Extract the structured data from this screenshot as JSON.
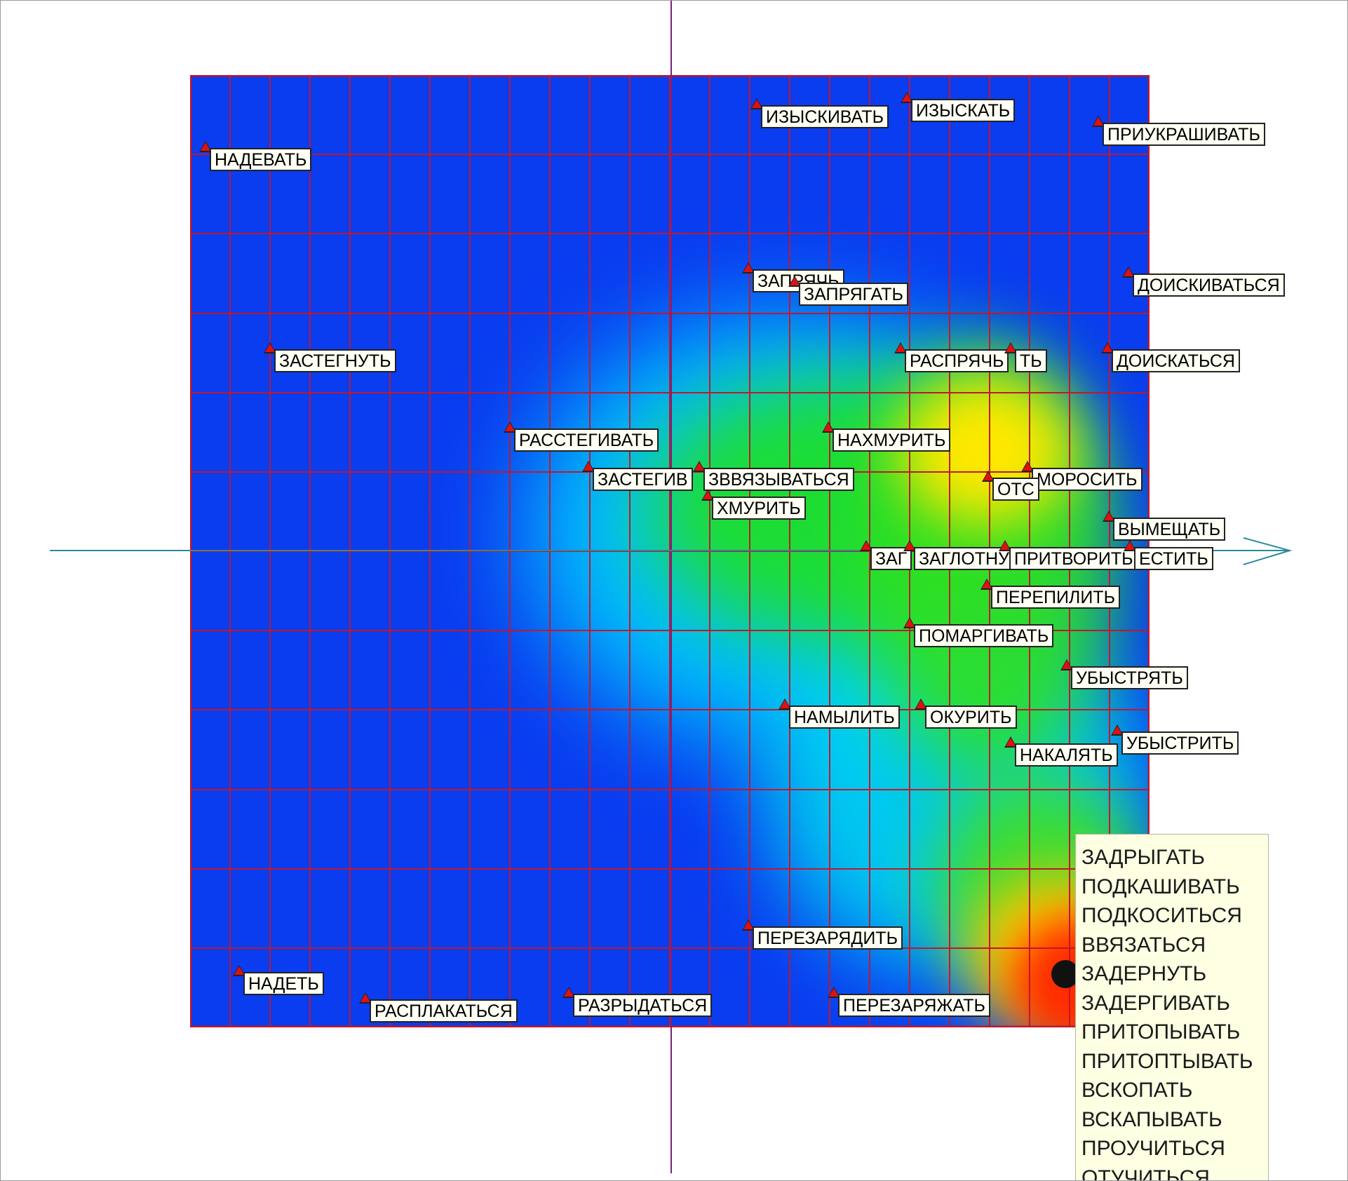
{
  "colors": {
    "low": "#0a3cf0",
    "mid": "#00e5ff",
    "green": "#18e018",
    "yellow": "#ffee00",
    "high": "#ff2a00",
    "grid_line": "#c0182c",
    "axis_vertical": "#7a2080",
    "axis_horizontal": "#2a8a9a",
    "tooltip_bg": "#ffffe3"
  },
  "grid": {
    "columns": 24,
    "rows": 12
  },
  "points": [
    {
      "label": "НАДЕВАТЬ"
    },
    {
      "label": "ИЗЫСКИВАТЬ"
    },
    {
      "label": "ИЗЫСКАТЬ"
    },
    {
      "label": "ПРИУКРАШИВАТЬ"
    },
    {
      "label": "ЗАПРЯЧЬ"
    },
    {
      "label": "ЗАПРЯГАТЬ"
    },
    {
      "label": "ДОИСКИВАТЬСЯ"
    },
    {
      "label": "ЗАСТЕГНУТЬ"
    },
    {
      "label": "РАСПРЯЧЬ"
    },
    {
      "label": "ТЬ"
    },
    {
      "label": "ДОИСКАТЬСЯ"
    },
    {
      "label": "РАССТЕГИВАТЬ"
    },
    {
      "label": "НАХМУРИТЬ"
    },
    {
      "label": "ЗАСТЕГИВ"
    },
    {
      "label": "ЗВВЯЗЫВАТЬСЯ"
    },
    {
      "label": "МОРОСИТЬ"
    },
    {
      "label": "ОТС"
    },
    {
      "label": "ХМУРИТЬ"
    },
    {
      "label": "ВЫМЕЩАТЬ"
    },
    {
      "label": "ЗАГ"
    },
    {
      "label": "ЗАГЛОТНУ"
    },
    {
      "label": "ПРИТВОРИТЬ"
    },
    {
      "label": "ЕСТИТЬ"
    },
    {
      "label": "ПЕРЕПИЛИТЬ"
    },
    {
      "label": "ПОМАРГИВАТЬ"
    },
    {
      "label": "УБЫСТРЯТЬ"
    },
    {
      "label": "НАМЫЛИТЬ"
    },
    {
      "label": "ОКУРИТЬ"
    },
    {
      "label": "УБЫСТРИТЬ"
    },
    {
      "label": "НАКАЛЯТЬ"
    },
    {
      "label": "ПЕРЕЗАРЯДИТЬ"
    },
    {
      "label": "НАДЕТЬ"
    },
    {
      "label": "РАСПЛАКАТЬСЯ"
    },
    {
      "label": "РАЗРЫДАТЬСЯ"
    },
    {
      "label": "ПЕРЕЗАРЯЖАТЬ"
    }
  ],
  "tooltip": {
    "items": [
      "ЗАДРЫГАТЬ",
      "ПОДКАШИВАТЬ",
      "ПОДКОСИТЬСЯ",
      "ВВЯЗАТЬСЯ",
      "ЗАДЕРНУТЬ",
      "ЗАДЕРГИВАТЬ",
      "ПРИТОПЫВАТЬ",
      "ПРИТОПТЫВАТЬ",
      "ВСКОПАТЬ",
      "ВСКАПЫВАТЬ",
      "ПРОУЧИТЬСЯ",
      "ОТУЧИТЬСЯ"
    ]
  }
}
